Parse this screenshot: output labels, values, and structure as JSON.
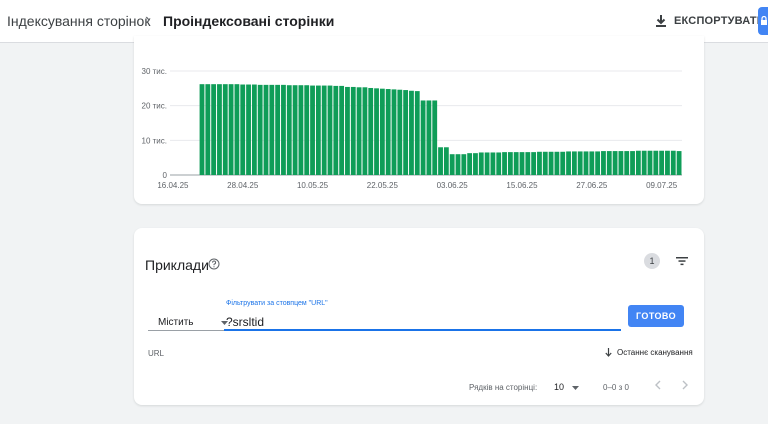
{
  "header": {
    "breadcrumb_parent": "Індексування сторінок",
    "breadcrumb_separator": "›",
    "breadcrumb_current": "Проіндексовані сторінки",
    "export_label": "ЕКСПОРТУВАТИ",
    "export_icon": "download-icon"
  },
  "chart_data": {
    "type": "bar",
    "color": "#0f9d58",
    "ylim": [
      0,
      30000
    ],
    "yticks": [
      {
        "value": 0,
        "label": "0"
      },
      {
        "value": 10000,
        "label": "10 тис."
      },
      {
        "value": 20000,
        "label": "20 тис."
      },
      {
        "value": 30000,
        "label": "30 тис."
      }
    ],
    "grid": true,
    "categories": [
      "16.04.25",
      "17.04.25",
      "18.04.25",
      "19.04.25",
      "20.04.25",
      "21.04.25",
      "22.04.25",
      "23.04.25",
      "24.04.25",
      "25.04.25",
      "26.04.25",
      "27.04.25",
      "28.04.25",
      "29.04.25",
      "30.04.25",
      "01.05.25",
      "02.05.25",
      "03.05.25",
      "04.05.25",
      "05.05.25",
      "06.05.25",
      "07.05.25",
      "08.05.25",
      "09.05.25",
      "10.05.25",
      "11.05.25",
      "12.05.25",
      "13.05.25",
      "14.05.25",
      "15.05.25",
      "16.05.25",
      "17.05.25",
      "18.05.25",
      "19.05.25",
      "20.05.25",
      "21.05.25",
      "22.05.25",
      "23.05.25",
      "24.05.25",
      "25.05.25",
      "26.05.25",
      "27.05.25",
      "28.05.25",
      "29.05.25",
      "30.05.25",
      "31.05.25",
      "01.06.25",
      "02.06.25",
      "03.06.25",
      "04.06.25",
      "05.06.25",
      "06.06.25",
      "07.06.25",
      "08.06.25",
      "09.06.25",
      "10.06.25",
      "11.06.25",
      "12.06.25",
      "13.06.25",
      "14.06.25",
      "15.06.25",
      "16.06.25",
      "17.06.25",
      "18.06.25",
      "19.06.25",
      "20.06.25",
      "21.06.25",
      "22.06.25",
      "23.06.25",
      "24.06.25",
      "25.06.25",
      "26.06.25",
      "27.06.25",
      "28.06.25",
      "29.06.25",
      "30.06.25",
      "01.07.25",
      "02.07.25",
      "03.07.25",
      "04.07.25",
      "05.07.25",
      "06.07.25",
      "07.07.25",
      "08.07.25",
      "09.07.25",
      "10.07.25",
      "11.07.25",
      "12.07.25"
    ],
    "xtick_labels": [
      "16.04.25",
      "28.04.25",
      "10.05.25",
      "22.05.25",
      "03.06.25",
      "15.06.25",
      "27.06.25",
      "09.07.25"
    ],
    "values": [
      0,
      0,
      0,
      0,
      0,
      26200,
      26200,
      26200,
      26200,
      26200,
      26200,
      26200,
      26100,
      26100,
      26100,
      26000,
      26000,
      26000,
      26000,
      26000,
      25900,
      25900,
      25900,
      25900,
      25800,
      25800,
      25800,
      25800,
      25700,
      25700,
      25400,
      25400,
      25300,
      25300,
      25100,
      25000,
      24900,
      24800,
      24700,
      24600,
      24500,
      24300,
      24200,
      21500,
      21500,
      21500,
      8000,
      8000,
      6000,
      6000,
      6000,
      6300,
      6300,
      6500,
      6500,
      6500,
      6500,
      6600,
      6600,
      6600,
      6600,
      6600,
      6600,
      6700,
      6700,
      6700,
      6700,
      6700,
      6800,
      6800,
      6800,
      6800,
      6800,
      6800,
      6900,
      6900,
      6900,
      6900,
      6900,
      6900,
      7000,
      7000,
      7000,
      7000,
      7000,
      7000,
      7000,
      6900
    ]
  },
  "examples": {
    "title": "Приклади",
    "help_icon": "help-icon",
    "filter_count": "1",
    "filter_icon": "filter-icon",
    "operator_value": "Містить",
    "filter_label": "Фільтрувати за стовпцем \"URL\"",
    "filter_value": "?srsltid",
    "done_label": "ГОТОВО",
    "col_url": "URL",
    "col_last_scan": "Останнє сканування",
    "rows_per_page_label": "Рядків на сторінці:",
    "rows_per_page_value": "10",
    "range_text": "0–0 з 0"
  }
}
